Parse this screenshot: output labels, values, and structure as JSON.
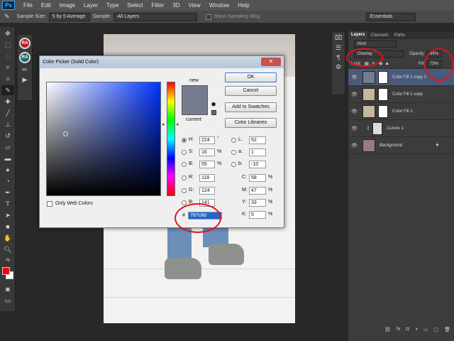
{
  "app": {
    "logo": "Ps"
  },
  "menu": [
    "File",
    "Edit",
    "Image",
    "Layer",
    "Type",
    "Select",
    "Filter",
    "3D",
    "View",
    "Window",
    "Help"
  ],
  "options": {
    "sample_size_label": "Sample Size:",
    "sample_size_value": "5 by 5 Average",
    "sample_label": "Sample:",
    "sample_value": "All Layers",
    "show_ring": "Show Sampling Ring",
    "workspace": "Essentials"
  },
  "actions": {
    "btn1": "RA",
    "btn2": "RA"
  },
  "layers_panel": {
    "tabs": [
      "Layers",
      "Channels",
      "Paths"
    ],
    "kind": "Kind",
    "blend_mode": "Overlay",
    "opacity_label": "Opacity:",
    "opacity_value": "84%",
    "lock_label": "Lock:",
    "fill_label": "Fill:",
    "fill_value": "73%",
    "layers": [
      {
        "name": "Color Fill 1 copy 2",
        "thumb": "#767c8d"
      },
      {
        "name": "Color Fill 1 copy",
        "thumb": "#c5b99a"
      },
      {
        "name": "Color Fill 1",
        "thumb": "#c5b99a"
      },
      {
        "name": "Curves 1",
        "thumb": "#555555"
      },
      {
        "name": "Background",
        "thumb": "#9a7a7a"
      }
    ]
  },
  "dialog": {
    "title": "Color Picker (Solid Color)",
    "close": "✕",
    "ok": "OK",
    "cancel": "Cancel",
    "add_swatches": "Add to Swatches",
    "libraries": "Color Libraries",
    "new_label": "new",
    "current_label": "current",
    "new_color": "#767c8d",
    "current_color": "#767c8d",
    "only_web": "Only Web Colors",
    "hash": "#",
    "hex": "767c8d",
    "fields": {
      "H": "224",
      "S": "16",
      "B": "55",
      "R": "118",
      "G": "124",
      "Bb": "141",
      "L": "52",
      "a": "1",
      "b": "-10",
      "C": "58",
      "M": "47",
      "Y": "33",
      "K": "5"
    },
    "units": {
      "deg": "°",
      "pct": "%"
    }
  },
  "colors": {
    "foreground": "#ff0000",
    "background": "#ffffff",
    "accent": "#e0141e"
  }
}
